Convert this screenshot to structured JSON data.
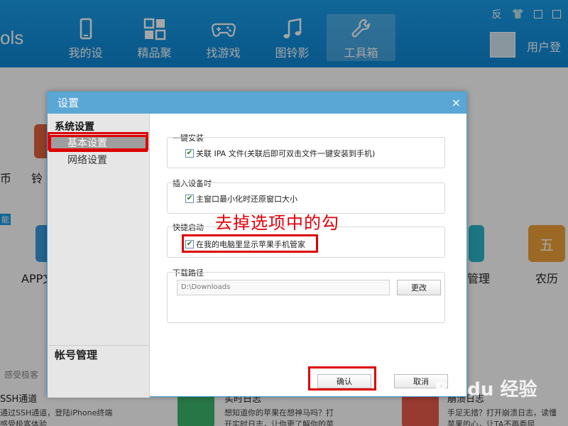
{
  "app": {
    "brand_fragment": "ols",
    "nav": [
      {
        "label": "我的设",
        "icon": "phone-icon"
      },
      {
        "label": "精品聚",
        "icon": "grid-icon"
      },
      {
        "label": "找游戏",
        "icon": "gamepad-icon"
      },
      {
        "label": "图铃影",
        "icon": "music-note-icon"
      },
      {
        "label": "工具箱",
        "icon": "wrench-icon",
        "active": true
      }
    ],
    "window_controls": {
      "feedback": "反",
      "shirt": "shirt-icon",
      "menu": "menu-icon",
      "minimize": "minimize-icon"
    },
    "user_login": "用户登"
  },
  "background": {
    "left_frag_1": "币",
    "left_frag_2": "铃",
    "left_frag_3": "能",
    "left_app_label": "APP文",
    "right_label_1": "管理",
    "right_label_2": "农历",
    "right_tile_glyph": "五",
    "bottom_section": "感受极客",
    "bottom_item_1_title": "SSH通道",
    "bottom_item_1_desc": "通过SSH通道，登陆iPhone终端",
    "bottom_item_1_desc2": "感受极客体验",
    "bottom_item_2_title": "实时日志",
    "bottom_item_2_desc": "想知道你的苹果在想神马吗？打",
    "bottom_item_2_desc2": "开实时日志，让你更了解你的苹",
    "bottom_item_3_title": "崩溃日志",
    "bottom_item_3_desc": "手足无措？打开崩溃日志，读懂",
    "bottom_item_3_desc2": "苹果的心，让TA不再委屈"
  },
  "dialog": {
    "title": "设置",
    "close": "×",
    "sidebar": {
      "section": "系统设置",
      "items": [
        {
          "label": "基本设置",
          "active": true
        },
        {
          "label": "网络设置",
          "active": false
        }
      ],
      "footer": "帐号管理"
    },
    "groups": {
      "one_click_install": {
        "label": "一键安装",
        "option": "关联 IPA 文件(关联后即可双击文件一键安装到手机)",
        "checked": true
      },
      "insert_device": {
        "label": "插入设备时",
        "option": "主窗口最小化时还原窗口大小",
        "checked": true
      },
      "quick_start": {
        "label": "快捷启动",
        "option": "在我的电脑里显示苹果手机管家",
        "checked": true
      },
      "download_path": {
        "label": "下载路径",
        "value": "D:\\Downloads",
        "change_button": "更改"
      }
    },
    "buttons": {
      "ok": "确认",
      "cancel": "取消"
    }
  },
  "annotation": {
    "text": "去掉选项中的勾",
    "color": "#e0000b"
  },
  "watermark": "Baidu 经验",
  "colors": {
    "topbar": "#1a9ee8",
    "dialog_title": "#5aa7d5",
    "highlight": "#dd0000"
  }
}
